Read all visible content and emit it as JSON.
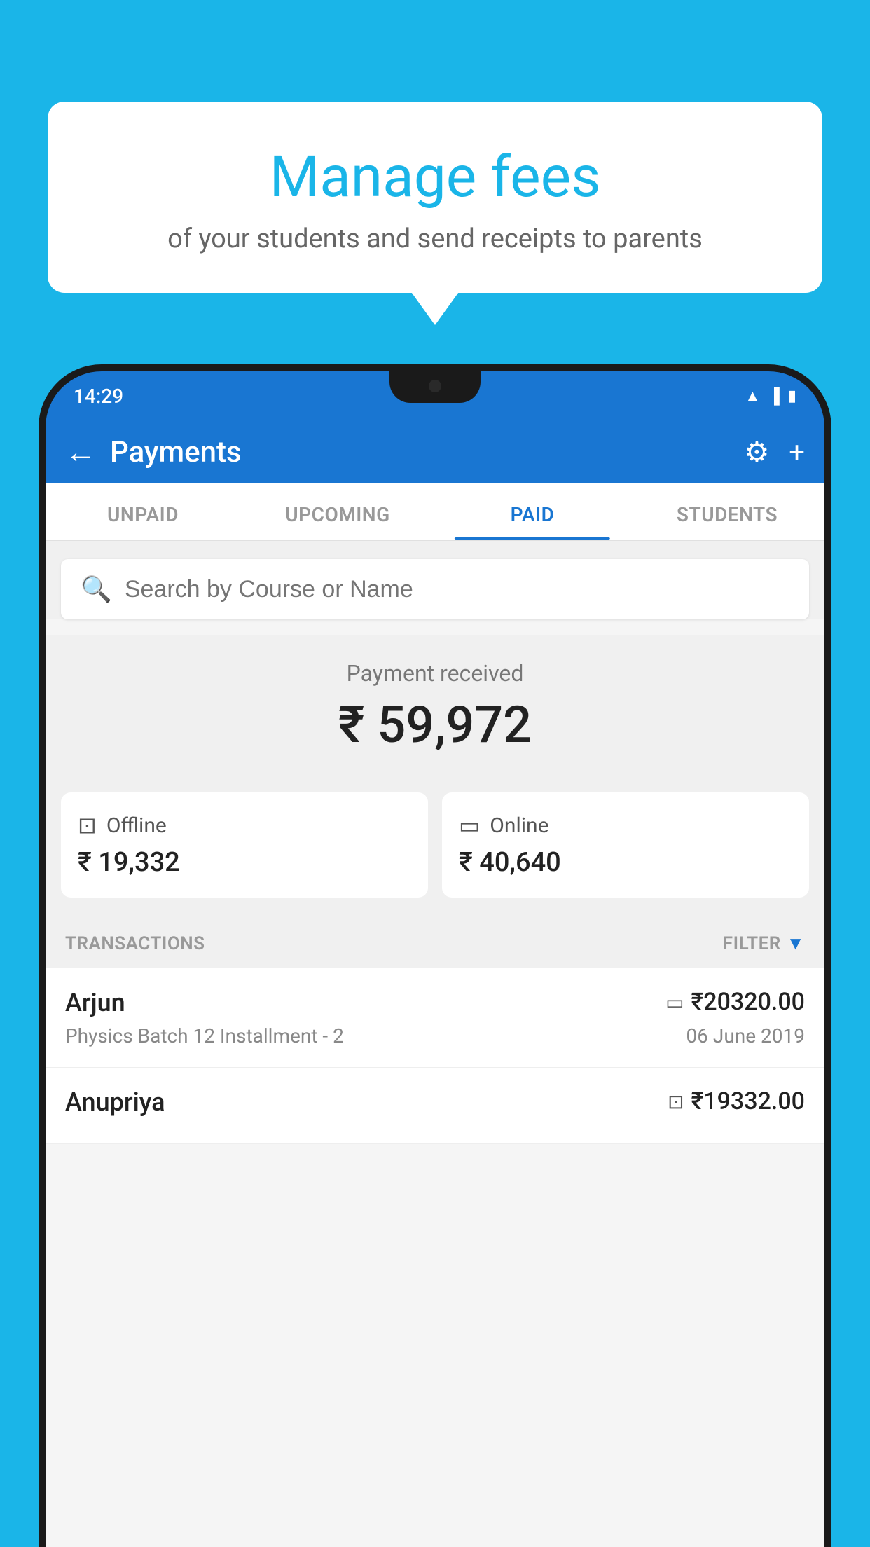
{
  "background_color": "#1ab5e8",
  "bubble": {
    "title": "Manage fees",
    "subtitle": "of your students and send receipts to parents"
  },
  "status_bar": {
    "time": "14:29",
    "icons": [
      "wifi",
      "signal",
      "battery"
    ]
  },
  "top_bar": {
    "title": "Payments",
    "back_label": "←",
    "gear_label": "⚙",
    "plus_label": "+"
  },
  "tabs": [
    {
      "label": "UNPAID",
      "active": false
    },
    {
      "label": "UPCOMING",
      "active": false
    },
    {
      "label": "PAID",
      "active": true
    },
    {
      "label": "STUDENTS",
      "active": false
    }
  ],
  "search": {
    "placeholder": "Search by Course or Name"
  },
  "payment_summary": {
    "label": "Payment received",
    "amount": "₹ 59,972"
  },
  "payment_cards": [
    {
      "icon": "offline",
      "label": "Offline",
      "amount": "₹ 19,332"
    },
    {
      "icon": "online",
      "label": "Online",
      "amount": "₹ 40,640"
    }
  ],
  "transactions_header": {
    "label": "TRANSACTIONS",
    "filter_label": "FILTER"
  },
  "transactions": [
    {
      "name": "Arjun",
      "payment_type": "online",
      "amount": "₹20320.00",
      "course": "Physics Batch 12 Installment - 2",
      "date": "06 June 2019"
    },
    {
      "name": "Anupriya",
      "payment_type": "offline",
      "amount": "₹19332.00",
      "course": "",
      "date": ""
    }
  ]
}
